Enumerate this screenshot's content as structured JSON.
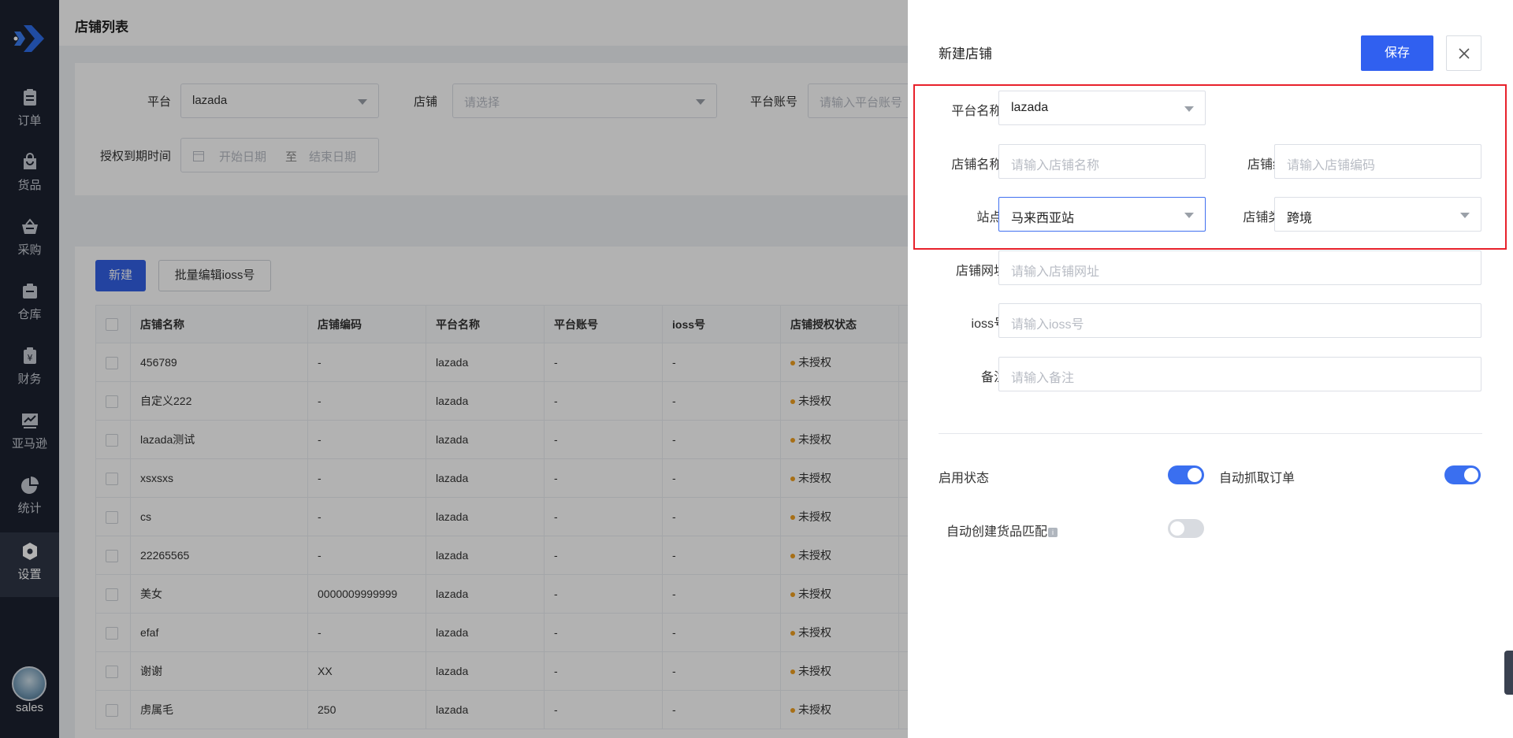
{
  "sidebar": {
    "items": [
      {
        "label": "订单",
        "icon": "order-icon"
      },
      {
        "label": "货品",
        "icon": "goods-icon"
      },
      {
        "label": "采购",
        "icon": "purchase-icon"
      },
      {
        "label": "仓库",
        "icon": "warehouse-icon"
      },
      {
        "label": "财务",
        "icon": "finance-icon"
      },
      {
        "label": "亚马逊",
        "icon": "amazon-chart-icon"
      },
      {
        "label": "统计",
        "icon": "statistics-pie-icon"
      },
      {
        "label": "设置",
        "icon": "settings-icon"
      }
    ],
    "active": "设置",
    "user": "sales"
  },
  "page": {
    "title": "店铺列表"
  },
  "filters": {
    "platform_label": "平台",
    "platform_value": "lazada",
    "store_label": "店铺",
    "store_placeholder": "请选择",
    "account_label": "平台账号",
    "account_placeholder": "请输入平台账号",
    "expire_label": "授权到期时间",
    "start_placeholder": "开始日期",
    "range_sep": "至",
    "end_placeholder": "结束日期"
  },
  "toolbar": {
    "new_label": "新建",
    "batch_label": "批量编辑ioss号"
  },
  "table": {
    "columns": [
      "店铺名称",
      "店铺编码",
      "平台名称",
      "平台账号",
      "ioss号",
      "店铺授权状态"
    ],
    "rows": [
      [
        "456789",
        "-",
        "lazada",
        "-",
        "-",
        "未授权"
      ],
      [
        "自定义222",
        "-",
        "lazada",
        "-",
        "-",
        "未授权"
      ],
      [
        "lazada测试",
        "-",
        "lazada",
        "-",
        "-",
        "未授权"
      ],
      [
        "xsxsxs",
        "-",
        "lazada",
        "-",
        "-",
        "未授权"
      ],
      [
        "cs",
        "-",
        "lazada",
        "-",
        "-",
        "未授权"
      ],
      [
        "22265565",
        "-",
        "lazada",
        "-",
        "-",
        "未授权"
      ],
      [
        "美女",
        "0000009999999",
        "lazada",
        "-",
        "-",
        "未授权"
      ],
      [
        "efaf",
        "-",
        "lazada",
        "-",
        "-",
        "未授权"
      ],
      [
        "谢谢",
        "XX",
        "lazada",
        "-",
        "-",
        "未授权"
      ],
      [
        "虏属毛",
        "250",
        "lazada",
        "-",
        "-",
        "未授权"
      ]
    ]
  },
  "drawer": {
    "title": "新建店铺",
    "save_label": "保存",
    "platform_name_label": "平台名称",
    "platform_name_value": "lazada",
    "store_name_label": "店铺名称",
    "store_name_placeholder": "请输入店铺名称",
    "store_code_label": "店铺编码",
    "store_code_placeholder": "请输入店铺编码",
    "site_label": "站点",
    "site_value": "马来西亚站",
    "store_type_label": "店铺类别",
    "store_type_value": "跨境",
    "store_url_label": "店铺网址",
    "store_url_placeholder": "请输入店铺网址",
    "ioss_label": "ioss号",
    "ioss_placeholder": "请输入ioss号",
    "remark_label": "备注",
    "remark_placeholder": "请输入备注",
    "enable_label": "启用状态",
    "enable_on": true,
    "auto_fetch_label": "自动抓取订单",
    "auto_fetch_on": true,
    "auto_match_label": "自动创建货品匹配",
    "auto_match_on": false,
    "required_mark": "*",
    "info_glyph": "i"
  },
  "colors": {
    "primary": "#3360e6",
    "sidebar": "#1c2230",
    "highlight": "#e8212b",
    "warning_dot": "#f0a020"
  }
}
